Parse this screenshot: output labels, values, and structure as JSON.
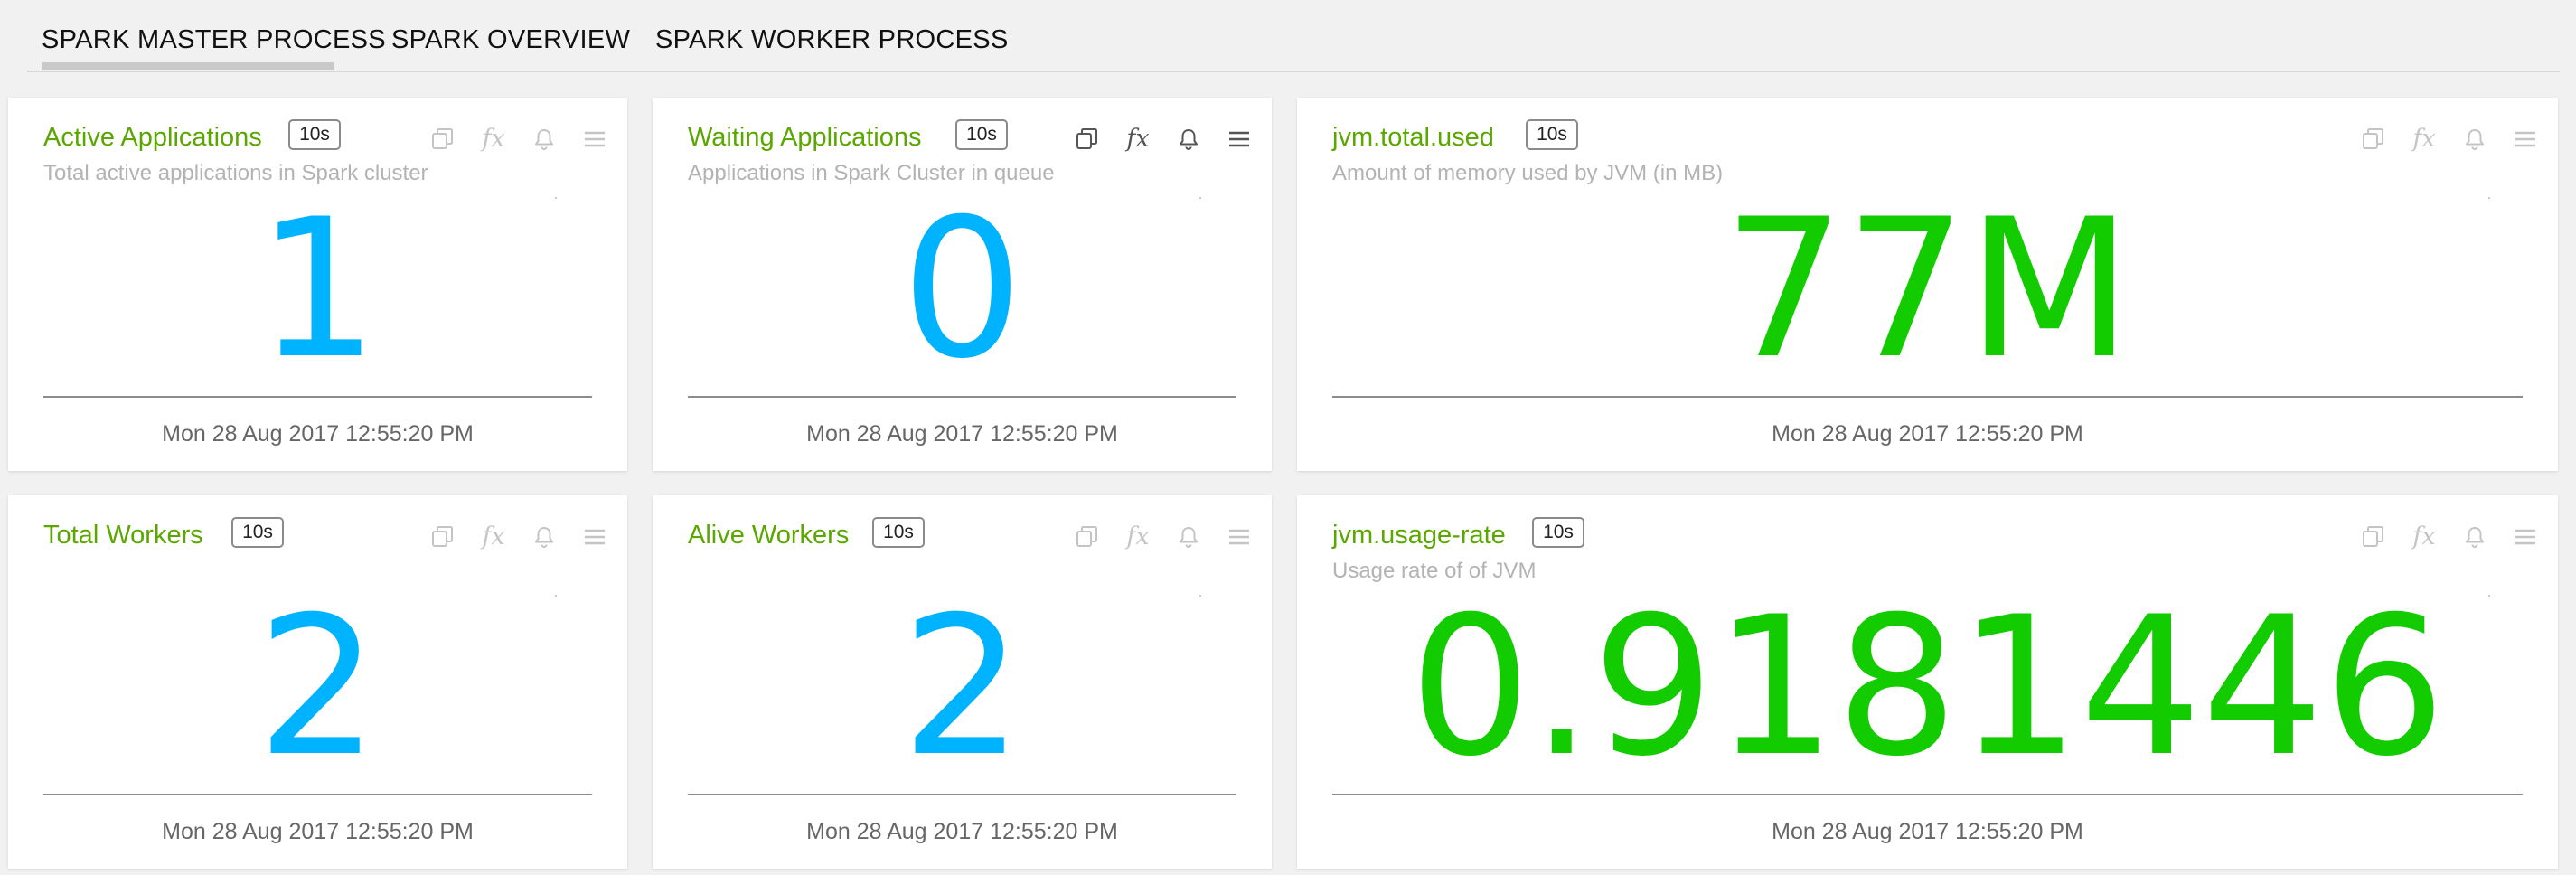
{
  "tabs": [
    {
      "label": "SPARK MASTER PROCESS",
      "active": true
    },
    {
      "label": "SPARK OVERVIEW",
      "active": false
    },
    {
      "label": "SPARK WORKER PROCESS",
      "active": false
    }
  ],
  "colors": {
    "title_green": "#5aa700",
    "value_blue": "#00b3ff",
    "value_green": "#12cc00",
    "icon_gray": "#c4c4c4",
    "icon_dark": "#555555"
  },
  "icons": [
    "copy-icon",
    "fx-icon",
    "bell-icon",
    "menu-icon"
  ],
  "fx_glyph": "fx",
  "cards": [
    {
      "title": "Active Applications",
      "interval": "10s",
      "subtitle": "Total active applications in Spark cluster",
      "value": "1",
      "timestamp": "Mon 28 Aug 2017 12:55:20 PM"
    },
    {
      "title": "Waiting Applications",
      "interval": "10s",
      "subtitle": "Applications in Spark Cluster in queue",
      "value": "0",
      "timestamp": "Mon 28 Aug 2017 12:55:20 PM"
    },
    {
      "title": "jvm.total.used",
      "interval": "10s",
      "subtitle": "Amount of memory used by JVM (in MB)",
      "value": "77M",
      "timestamp": "Mon 28 Aug 2017 12:55:20 PM"
    },
    {
      "title": "Total Workers",
      "interval": "10s",
      "subtitle": "",
      "value": "2",
      "timestamp": "Mon 28 Aug 2017 12:55:20 PM"
    },
    {
      "title": "Alive Workers",
      "interval": "10s",
      "subtitle": "",
      "value": "2",
      "timestamp": "Mon 28 Aug 2017 12:55:20 PM"
    },
    {
      "title": "jvm.usage-rate",
      "interval": "10s",
      "subtitle": "Usage rate of of JVM",
      "value": "0.9181446",
      "timestamp": "Mon 28 Aug 2017 12:55:20 PM"
    }
  ]
}
